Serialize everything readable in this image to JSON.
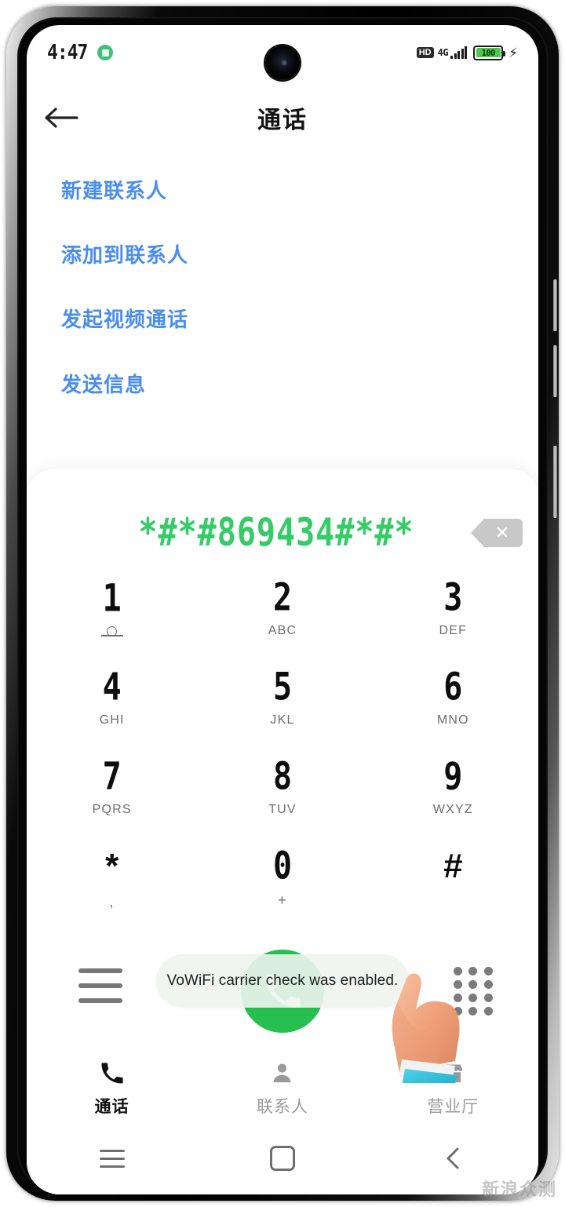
{
  "status_bar": {
    "clock": "4:47",
    "notification_badge_icon": "app-notification-icon",
    "hd_label": "HD",
    "network_type": "4G",
    "signal_icon": "signal-bars-icon",
    "battery_level": "100",
    "charging_icon": "charging-bolt-icon"
  },
  "header": {
    "back_icon": "back-arrow-icon",
    "title": "通话"
  },
  "action_links": [
    {
      "label": "新建联系人"
    },
    {
      "label": "添加到联系人"
    },
    {
      "label": "发起视频通话"
    },
    {
      "label": "发送信息"
    }
  ],
  "dialpad": {
    "dialed_number": "*#*#869434#*#*",
    "backspace_icon": "backspace-icon",
    "backspace_glyph": "✕",
    "keys": [
      {
        "digit": "1",
        "sub": "",
        "icon": "voicemail-icon"
      },
      {
        "digit": "2",
        "sub": "ABC",
        "icon": ""
      },
      {
        "digit": "3",
        "sub": "DEF",
        "icon": ""
      },
      {
        "digit": "4",
        "sub": "GHI",
        "icon": ""
      },
      {
        "digit": "5",
        "sub": "JKL",
        "icon": ""
      },
      {
        "digit": "6",
        "sub": "MNO",
        "icon": ""
      },
      {
        "digit": "7",
        "sub": "PQRS",
        "icon": ""
      },
      {
        "digit": "8",
        "sub": "TUV",
        "icon": ""
      },
      {
        "digit": "9",
        "sub": "WXYZ",
        "icon": ""
      },
      {
        "digit": "*",
        "sub": ",",
        "icon": ""
      },
      {
        "digit": "0",
        "sub": "+",
        "icon": ""
      },
      {
        "digit": "#",
        "sub": "",
        "icon": ""
      }
    ],
    "menu_icon": "hamburger-menu-icon",
    "call_icon": "phone-call-icon",
    "keypad_toggle_icon": "keypad-dots-icon",
    "call_button_color": "#27bf4f"
  },
  "toast": {
    "message": "VoWiFi carrier check was enabled."
  },
  "tab_bar": [
    {
      "label": "通话",
      "icon": "phone-icon",
      "active": true
    },
    {
      "label": "联系人",
      "icon": "person-icon",
      "active": false
    },
    {
      "label": "营业厅",
      "icon": "store-icon",
      "active": false
    }
  ],
  "android_nav": {
    "recents_icon": "recents-icon",
    "home_icon": "home-square-icon",
    "back_icon": "back-chevron-icon"
  },
  "cursor": {
    "icon": "pointing-hand-cursor"
  },
  "watermark": {
    "text": "新浪众测"
  },
  "colors": {
    "link_blue": "#4a8df0",
    "dial_green": "#33cc66",
    "call_green": "#27bf4f",
    "toast_bg": "#eef4ee"
  }
}
